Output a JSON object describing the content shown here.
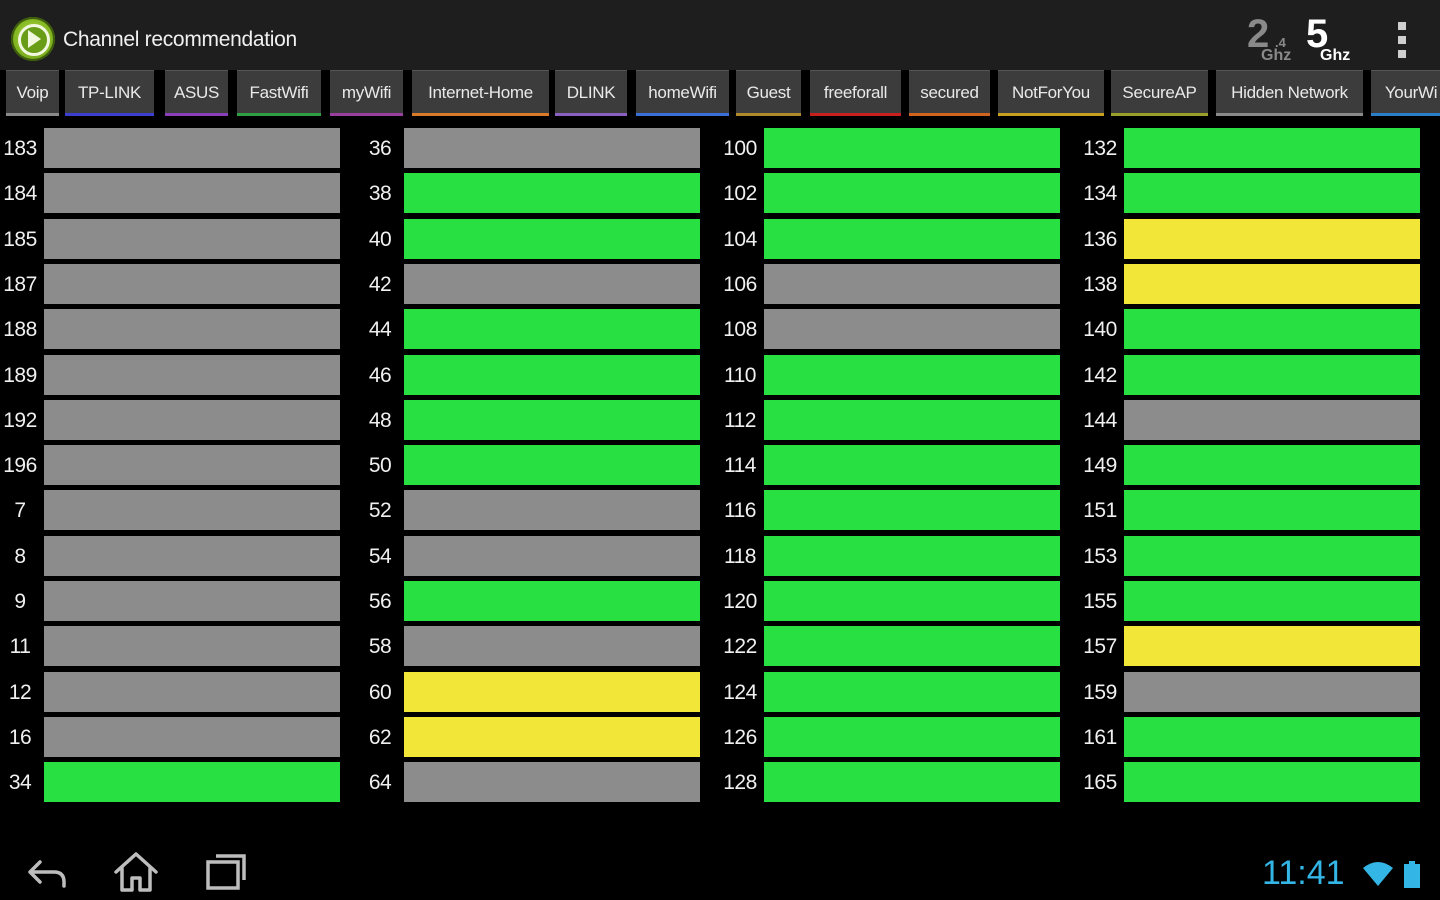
{
  "app": {
    "title": "Channel recommendation",
    "icon": "app-logo-icon"
  },
  "bands": {
    "b24": {
      "number": "2",
      "sub": ".4",
      "unit": "Ghz",
      "active": false
    },
    "b5": {
      "number": "5",
      "unit": "Ghz",
      "active": true
    }
  },
  "tabs": [
    {
      "label": "Voip",
      "color": "#8a8a8a"
    },
    {
      "label": "TP-LINK",
      "color": "#3a3fcf"
    },
    {
      "label": "ASUS",
      "color": "#8a3fb8"
    },
    {
      "label": "FastWifi",
      "color": "#2ea043"
    },
    {
      "label": "myWifi",
      "color": "#9a3fa0"
    },
    {
      "label": "Internet-Home",
      "color": "#d97a2a"
    },
    {
      "label": "DLINK",
      "color": "#8a5fc0"
    },
    {
      "label": "homeWifi",
      "color": "#3a6fd8"
    },
    {
      "label": "Guest",
      "color": "#b08a2a"
    },
    {
      "label": "freeforall",
      "color": "#c8201f"
    },
    {
      "label": "secured",
      "color": "#d0641e"
    },
    {
      "label": "NotForYou",
      "color": "#c8a020"
    },
    {
      "label": "SecureAP",
      "color": "#9aa02a"
    },
    {
      "label": "Hidden Network",
      "color": "#8a8a8a"
    },
    {
      "label": "YourWi",
      "color": "#2a7fc8"
    }
  ],
  "colors": {
    "recommended": "#28e042",
    "acceptable": "#f2e638",
    "unavailable": "#8c8c8c"
  },
  "columns": [
    [
      {
        "channel": "183",
        "status": "unavailable"
      },
      {
        "channel": "184",
        "status": "unavailable"
      },
      {
        "channel": "185",
        "status": "unavailable"
      },
      {
        "channel": "187",
        "status": "unavailable"
      },
      {
        "channel": "188",
        "status": "unavailable"
      },
      {
        "channel": "189",
        "status": "unavailable"
      },
      {
        "channel": "192",
        "status": "unavailable"
      },
      {
        "channel": "196",
        "status": "unavailable"
      },
      {
        "channel": "7",
        "status": "unavailable"
      },
      {
        "channel": "8",
        "status": "unavailable"
      },
      {
        "channel": "9",
        "status": "unavailable"
      },
      {
        "channel": "11",
        "status": "unavailable"
      },
      {
        "channel": "12",
        "status": "unavailable"
      },
      {
        "channel": "16",
        "status": "unavailable"
      },
      {
        "channel": "34",
        "status": "recommended"
      }
    ],
    [
      {
        "channel": "36",
        "status": "unavailable"
      },
      {
        "channel": "38",
        "status": "recommended"
      },
      {
        "channel": "40",
        "status": "recommended"
      },
      {
        "channel": "42",
        "status": "unavailable"
      },
      {
        "channel": "44",
        "status": "recommended"
      },
      {
        "channel": "46",
        "status": "recommended"
      },
      {
        "channel": "48",
        "status": "recommended"
      },
      {
        "channel": "50",
        "status": "recommended"
      },
      {
        "channel": "52",
        "status": "unavailable"
      },
      {
        "channel": "54",
        "status": "unavailable"
      },
      {
        "channel": "56",
        "status": "recommended"
      },
      {
        "channel": "58",
        "status": "unavailable"
      },
      {
        "channel": "60",
        "status": "acceptable"
      },
      {
        "channel": "62",
        "status": "acceptable"
      },
      {
        "channel": "64",
        "status": "unavailable"
      }
    ],
    [
      {
        "channel": "100",
        "status": "recommended"
      },
      {
        "channel": "102",
        "status": "recommended"
      },
      {
        "channel": "104",
        "status": "recommended"
      },
      {
        "channel": "106",
        "status": "unavailable"
      },
      {
        "channel": "108",
        "status": "unavailable"
      },
      {
        "channel": "110",
        "status": "recommended"
      },
      {
        "channel": "112",
        "status": "recommended"
      },
      {
        "channel": "114",
        "status": "recommended"
      },
      {
        "channel": "116",
        "status": "recommended"
      },
      {
        "channel": "118",
        "status": "recommended"
      },
      {
        "channel": "120",
        "status": "recommended"
      },
      {
        "channel": "122",
        "status": "recommended"
      },
      {
        "channel": "124",
        "status": "recommended"
      },
      {
        "channel": "126",
        "status": "recommended"
      },
      {
        "channel": "128",
        "status": "recommended"
      }
    ],
    [
      {
        "channel": "132",
        "status": "recommended"
      },
      {
        "channel": "134",
        "status": "recommended"
      },
      {
        "channel": "136",
        "status": "acceptable"
      },
      {
        "channel": "138",
        "status": "acceptable"
      },
      {
        "channel": "140",
        "status": "recommended"
      },
      {
        "channel": "142",
        "status": "recommended"
      },
      {
        "channel": "144",
        "status": "unavailable"
      },
      {
        "channel": "149",
        "status": "recommended"
      },
      {
        "channel": "151",
        "status": "recommended"
      },
      {
        "channel": "153",
        "status": "recommended"
      },
      {
        "channel": "155",
        "status": "recommended"
      },
      {
        "channel": "157",
        "status": "acceptable"
      },
      {
        "channel": "159",
        "status": "unavailable"
      },
      {
        "channel": "161",
        "status": "recommended"
      },
      {
        "channel": "165",
        "status": "recommended"
      }
    ]
  ],
  "system_bar": {
    "time": "11:41",
    "back_icon": "back-icon",
    "home_icon": "home-icon",
    "recents_icon": "recent-apps-icon",
    "wifi_icon": "wifi-icon",
    "battery_icon": "battery-icon"
  }
}
